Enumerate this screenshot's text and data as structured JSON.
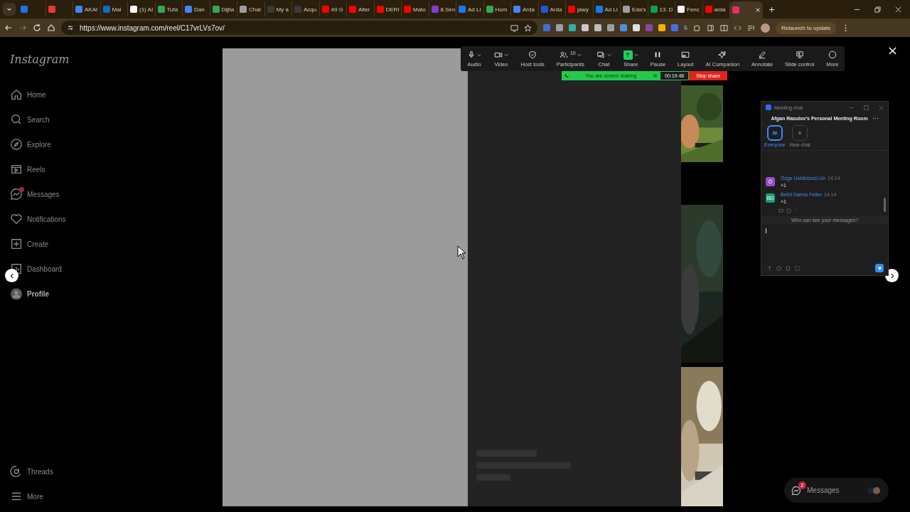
{
  "browser": {
    "tabs": [
      {
        "color": "#1a73e8",
        "selected": false
      },
      {
        "color": "#e53935",
        "selected": false
      },
      {
        "label": "AKAI",
        "color": "#4285f4",
        "selected": false
      },
      {
        "label": "Mai",
        "color": "#0f6cbd",
        "selected": false
      },
      {
        "label": "(1) AI",
        "color": "#ffffff",
        "selected": false
      },
      {
        "label": "Tufa",
        "color": "#34a853",
        "selected": false
      },
      {
        "label": "Dan",
        "color": "#4285f4",
        "selected": false
      },
      {
        "label": "Dijita",
        "color": "#34a853",
        "selected": false
      },
      {
        "label": "Chat",
        "color": "#9e9e9e",
        "selected": false
      },
      {
        "label": "My a",
        "color": "#3a3a3a",
        "selected": false
      },
      {
        "label": "Acqu",
        "color": "#3a3a3a",
        "selected": false
      },
      {
        "label": "49 G",
        "color": "#ff0000",
        "selected": false
      },
      {
        "label": "Alter",
        "color": "#ff0000",
        "selected": false
      },
      {
        "label": "DERI",
        "color": "#ff0000",
        "selected": false
      },
      {
        "label": "Mato",
        "color": "#ff0000",
        "selected": false
      },
      {
        "label": "8.Sen",
        "color": "#7e3fd6",
        "selected": false
      },
      {
        "label": "Ad Li",
        "color": "#1877f2",
        "selected": false
      },
      {
        "label": "Hom",
        "color": "#34a853",
        "selected": false
      },
      {
        "label": "Arda",
        "color": "#4285f4",
        "selected": false
      },
      {
        "label": "Arda",
        "color": "#1e5bd6",
        "selected": false
      },
      {
        "label": "jawy",
        "color": "#ff0000",
        "selected": false
      },
      {
        "label": "Ad Li",
        "color": "#1877f2",
        "selected": false
      },
      {
        "label": "Eda's",
        "color": "#9e9e9e",
        "selected": false
      },
      {
        "label": "13. D",
        "color": "#0f9d58",
        "selected": false
      },
      {
        "label": "Fenc",
        "color": "#ffffff",
        "selected": false
      },
      {
        "label": "arda",
        "color": "#ff0000",
        "selected": false
      },
      {
        "color": "#e1306c",
        "selected": true
      }
    ],
    "url": "https://www.instagram.com/reel/C17vrLVs7ov/",
    "extensions": [
      {
        "color": "#3b6fd8"
      },
      {
        "color": "#9aa0a6"
      },
      {
        "color": "#2bb3a3"
      },
      {
        "color": "#c8c8c8"
      },
      {
        "color": "#bdbdbd"
      },
      {
        "color": "#9aa0a6"
      },
      {
        "color": "#4a90e2"
      },
      {
        "color": "#e0e0e0"
      },
      {
        "color": "#8e44ad"
      },
      {
        "color": "#f4b400"
      },
      {
        "color": "#4a6fe3"
      }
    ],
    "extension_badge": "6",
    "relaunch_button": "Relaunch to update"
  },
  "sidebar": {
    "logo": "Instagram",
    "items": [
      {
        "label": "Home",
        "kind": "home",
        "selected": false
      },
      {
        "label": "Search",
        "kind": "search",
        "selected": false
      },
      {
        "label": "Explore",
        "kind": "compass",
        "selected": false
      },
      {
        "label": "Reels",
        "kind": "reels",
        "selected": false
      },
      {
        "label": "Messages",
        "kind": "messenger",
        "selected": false,
        "badge": true
      },
      {
        "label": "Notifications",
        "kind": "heart",
        "selected": false
      },
      {
        "label": "Create",
        "kind": "plus",
        "selected": false
      },
      {
        "label": "Dashboard",
        "kind": "chart",
        "selected": false
      },
      {
        "label": "Profile",
        "kind": "avatar",
        "selected": true
      }
    ],
    "bottom_items": [
      {
        "label": "Threads",
        "kind": "threads",
        "selected": false
      },
      {
        "label": "More",
        "kind": "menu",
        "selected": false
      }
    ]
  },
  "zoom_toolbar": {
    "items": [
      {
        "label": "Audio",
        "kind": "mic",
        "has_menu": true,
        "active": false
      },
      {
        "label": "Video",
        "kind": "camera",
        "has_menu": true,
        "active": false
      },
      {
        "label": "Host tools",
        "kind": "shield",
        "has_menu": false,
        "active": false
      },
      {
        "label": "Participants",
        "kind": "people",
        "has_menu": true,
        "active": false,
        "count": "10"
      },
      {
        "label": "Chat",
        "kind": "chat",
        "has_menu": true,
        "active": false
      },
      {
        "label": "Share",
        "kind": "share",
        "has_menu": true,
        "active": true
      },
      {
        "label": "Pause",
        "kind": "pause",
        "has_menu": false,
        "active": false
      },
      {
        "label": "Layout",
        "kind": "layout",
        "has_menu": false,
        "active": false
      },
      {
        "label": "AI Companion",
        "kind": "sparkle",
        "has_menu": false,
        "active": false
      },
      {
        "label": "Annotate",
        "kind": "pen",
        "has_menu": false,
        "active": false
      },
      {
        "label": "Slide control",
        "kind": "slides",
        "has_menu": false,
        "active": false
      },
      {
        "label": "More",
        "kind": "more",
        "has_menu": false,
        "active": false
      }
    ],
    "sharing_status": "You are screen sharing",
    "timer": "00:19:48",
    "stop_button": "Stop share"
  },
  "meeting_chat": {
    "title": "Meeting chat",
    "room": "Afgan Rasulov's Personal Meeting Room",
    "targets": [
      {
        "label": "Everyone",
        "kind": "everyone",
        "selected": true
      },
      {
        "label": "New chat",
        "kind": "new",
        "selected": false
      }
    ],
    "messages": [
      {
        "sender": "Özge Üstübüncü Ün",
        "time": "14:14",
        "initials": "Ö",
        "color": "#9b4dca",
        "text": "+1"
      },
      {
        "sender": "Betül Damla Felter",
        "time": "14:14",
        "initials": "BD",
        "color": "#16a37a",
        "text": "+1"
      }
    ],
    "privacy_link": "Who can see your messages?"
  },
  "messages_bar": {
    "label": "Messages",
    "badge": "2"
  }
}
